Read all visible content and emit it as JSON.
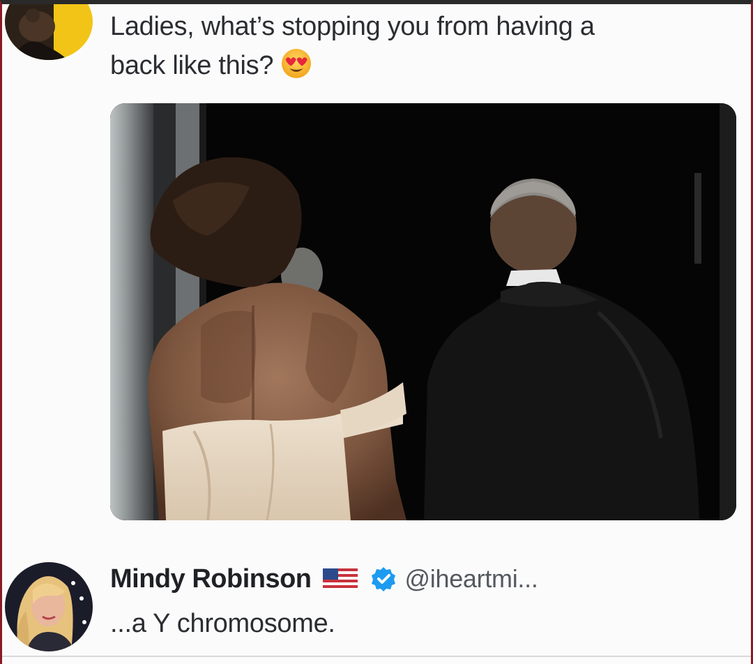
{
  "tweet": {
    "text_line1": "Ladies, what’s stopping you from having a",
    "text_line2": "back like this?",
    "emoji": "heart-eyes-emoji",
    "photo": "couple-walking-away-photo"
  },
  "reply": {
    "name": "Mindy Robinson",
    "flag": "us-flag-icon",
    "badge": "verified-badge-icon",
    "handle": "@iheartmi...",
    "text": "...a Y chromosome."
  },
  "colors": {
    "text": "#2b2d31",
    "handle": "#55595f",
    "verified": "#1d9bf0",
    "avatar_bg_top": "#f2c417"
  }
}
